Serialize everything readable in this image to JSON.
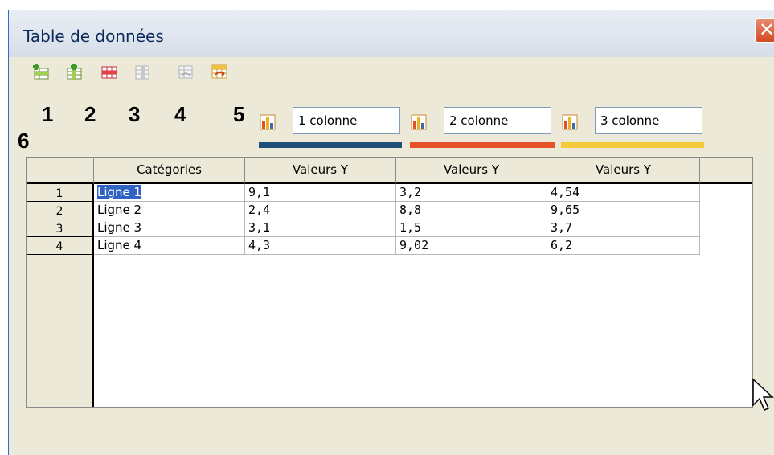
{
  "window": {
    "title": "Table de données",
    "close_glyph": "✕"
  },
  "toolbar": {
    "buttons": [
      {
        "icon": "insert-row-icon",
        "enabled": true
      },
      {
        "icon": "insert-column-icon",
        "enabled": true
      },
      {
        "icon": "delete-row-icon",
        "enabled": true
      },
      {
        "icon": "delete-column-icon",
        "enabled": false
      },
      {
        "icon": "move-column-icon",
        "enabled": false
      },
      {
        "icon": "move-row-icon",
        "enabled": true
      }
    ]
  },
  "markers": [
    "1",
    "2",
    "3",
    "4",
    "5",
    "6"
  ],
  "series": [
    {
      "name": "1 colonne",
      "color": "#1f4e79"
    },
    {
      "name": "2 colonne",
      "color": "#e8522a"
    },
    {
      "name": "3 colonne",
      "color": "#f4c93a"
    }
  ],
  "table": {
    "headers": [
      "Catégories",
      "Valeurs Y",
      "Valeurs Y",
      "Valeurs Y"
    ],
    "rows": [
      {
        "num": "1",
        "cells": [
          "Ligne 1",
          "9,1",
          "3,2",
          "4,54"
        ]
      },
      {
        "num": "2",
        "cells": [
          "Ligne 2",
          "2,4",
          "8,8",
          "9,65"
        ]
      },
      {
        "num": "3",
        "cells": [
          "Ligne 3",
          "3,1",
          "1,5",
          "3,7"
        ]
      },
      {
        "num": "4",
        "cells": [
          "Ligne 4",
          "4,3",
          "9,02",
          "6,2"
        ]
      }
    ]
  }
}
